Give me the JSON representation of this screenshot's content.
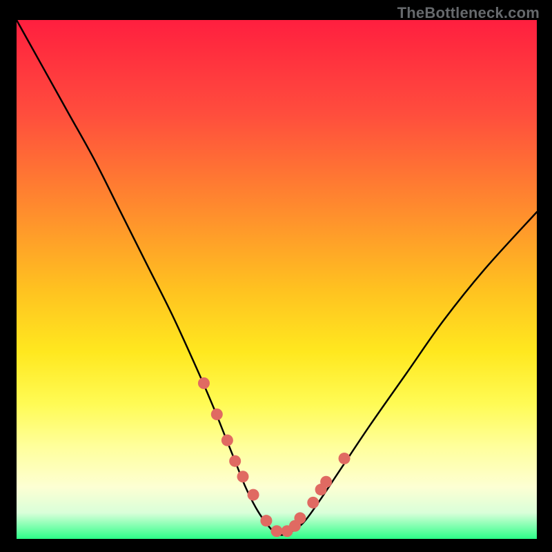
{
  "watermark": "TheBottleneck.com",
  "chart_data": {
    "type": "line",
    "title": "",
    "xlabel": "",
    "ylabel": "",
    "xlim": [
      0,
      100
    ],
    "ylim": [
      0,
      100
    ],
    "grid": false,
    "legend": false,
    "series": [
      {
        "name": "curve",
        "x": [
          0,
          5,
          10,
          15,
          20,
          25,
          30,
          35,
          38,
          40,
          42,
          44,
          46,
          48,
          50,
          52,
          55,
          58,
          62,
          68,
          75,
          82,
          90,
          100
        ],
        "values": [
          100,
          91,
          82,
          73,
          63,
          53,
          43,
          32,
          25,
          20,
          15,
          10,
          6,
          3,
          1,
          1,
          3,
          7,
          13,
          22,
          32,
          42,
          52,
          63
        ]
      },
      {
        "name": "dots",
        "x": [
          36,
          38.5,
          40.5,
          42,
          43.5,
          45.5,
          48,
          50,
          52,
          53.5,
          54.5,
          57,
          58.5,
          59.5,
          63
        ],
        "values": [
          30,
          24,
          19,
          15,
          12,
          8.5,
          3.5,
          1.5,
          1.5,
          2.5,
          4,
          7,
          9.5,
          11,
          15.5
        ]
      }
    ],
    "colors": {
      "curve": "#000000",
      "dots": "#e06a62",
      "background_top": "#ff1f3f",
      "background_bottom": "#2cff88"
    },
    "dot_radius_px": 8.5
  }
}
